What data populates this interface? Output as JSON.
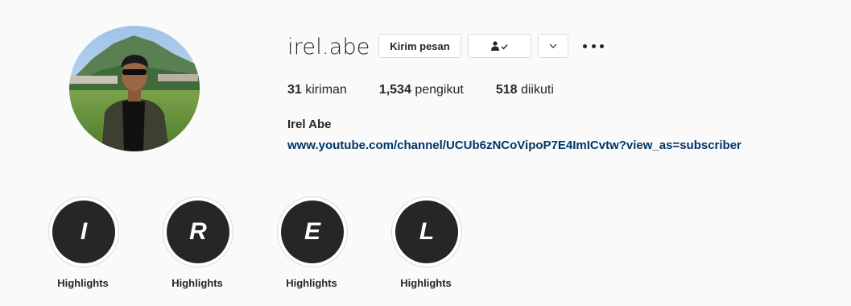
{
  "profile": {
    "username": "irel.abe",
    "full_name": "Irel Abe",
    "website": "www.youtube.com/channel/UCUb6zNCoVipoP7E4ImICvtw?view_as=subscriber"
  },
  "actions": {
    "message_label": "Kirim pesan",
    "following_icon": "person-check-icon",
    "dropdown_icon": "chevron-down-icon",
    "more_icon": "more-horizontal-icon"
  },
  "stats": {
    "posts": {
      "value": "31",
      "label": "kiriman"
    },
    "followers": {
      "value": "1,534",
      "label": "pengikut"
    },
    "following": {
      "value": "518",
      "label": "diikuti"
    }
  },
  "highlights": [
    {
      "letter": "I",
      "label": "Highlights"
    },
    {
      "letter": "R",
      "label": "Highlights"
    },
    {
      "letter": "E",
      "label": "Highlights"
    },
    {
      "letter": "L",
      "label": "Highlights"
    }
  ],
  "colors": {
    "text": "#262626",
    "link": "#003569",
    "border": "#dbdbdb",
    "background": "#fafafa",
    "highlight_fill": "#262626"
  }
}
